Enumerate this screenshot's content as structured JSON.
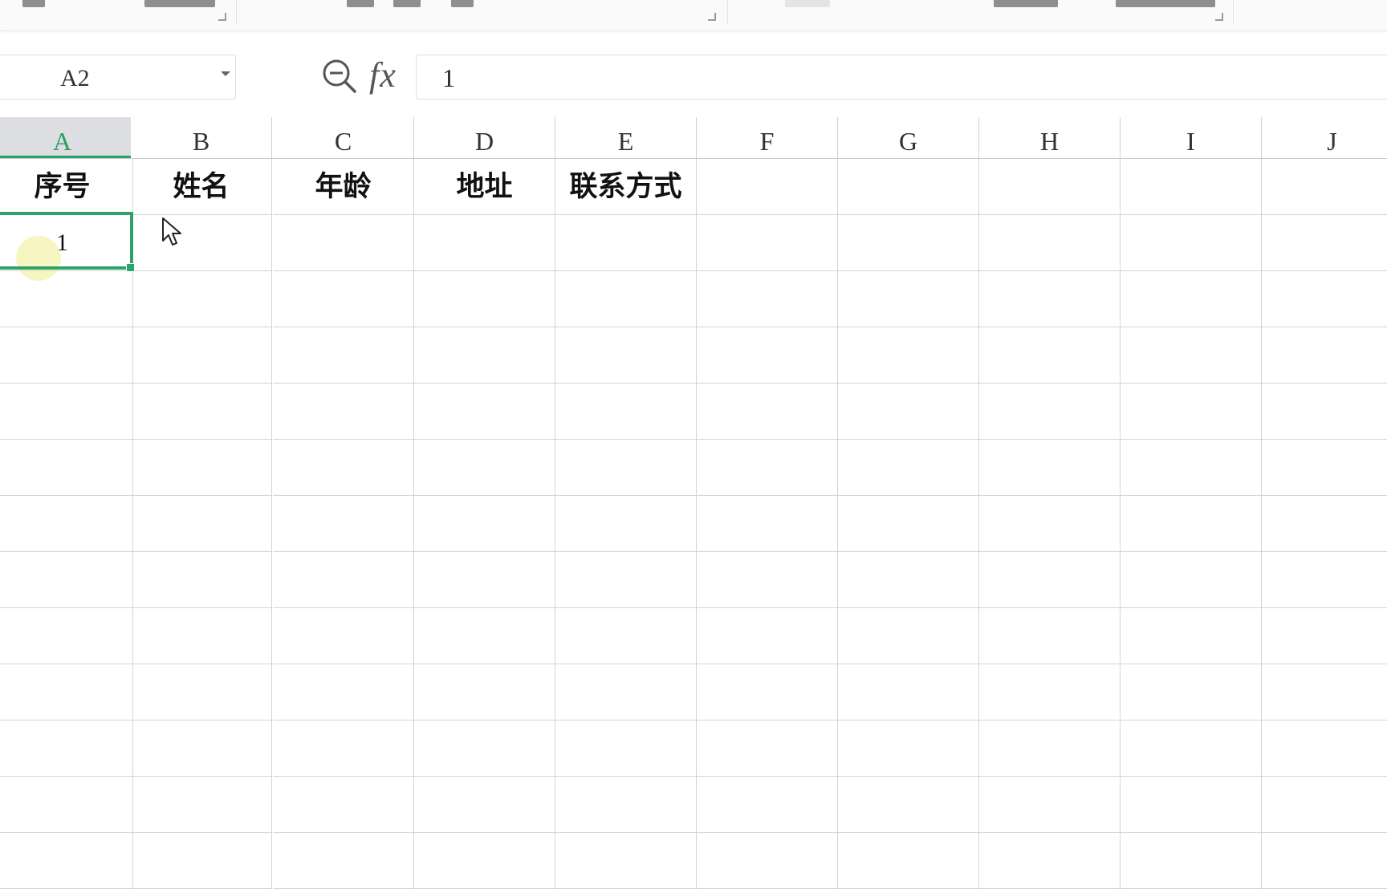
{
  "formula_bar": {
    "name_box_value": "A2",
    "fx_label": "fx",
    "formula_value": "1"
  },
  "columns": [
    "A",
    "B",
    "C",
    "D",
    "E",
    "F",
    "G",
    "H",
    "I",
    "J"
  ],
  "active_column": "A",
  "rows": [
    [
      "序号",
      "姓名",
      "年龄",
      "地址",
      "联系方式",
      "",
      "",
      "",
      "",
      ""
    ],
    [
      "1",
      "",
      "",
      "",
      "",
      "",
      "",
      "",
      "",
      ""
    ]
  ],
  "empty_rows": 11,
  "selected_cell": "A2",
  "colors": {
    "selection": "#2da36b",
    "grid_line": "#d4d4d4",
    "active_header_bg": "#dcdee2"
  },
  "icons": [
    "zoom-out-icon",
    "mouse-pointer-icon",
    "dropdown-caret-icon"
  ]
}
